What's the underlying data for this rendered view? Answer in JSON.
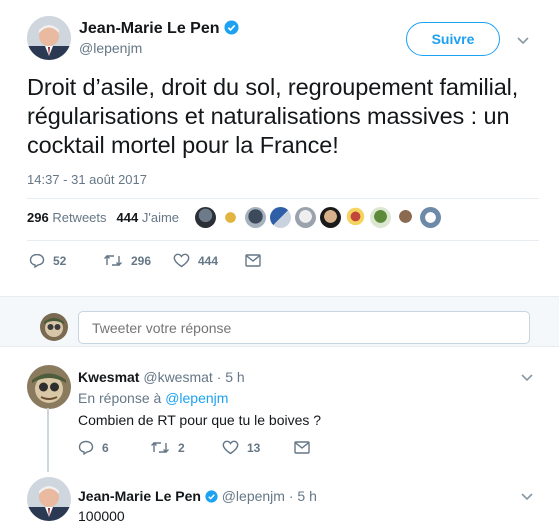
{
  "main_tweet": {
    "author_name": "Jean-Marie Le Pen",
    "author_handle": "@lepenjm",
    "follow_label": "Suivre",
    "text": "Droit d’asile, droit du sol, regroupement familial, régularisations et naturalisations massives : un cocktail mortel pour la France!",
    "timestamp": "14:37 - 31 août 2017",
    "retweets_count": "296",
    "retweets_label": "Retweets",
    "likes_count": "444",
    "likes_label": "J'aime",
    "actions": {
      "replies": "52",
      "retweets": "296",
      "likes": "444"
    }
  },
  "reply_box": {
    "placeholder": "Tweeter votre réponse"
  },
  "replies": [
    {
      "author_name": "Kwesmat",
      "author_handle": "@kwesmat",
      "time": "· 5 h",
      "reply_to_prefix": "En réponse à",
      "reply_to_handle": "@lepenjm",
      "text": "Combien de RT pour que tu le boives ?",
      "actions": {
        "replies": "6",
        "retweets": "2",
        "likes": "13"
      }
    },
    {
      "author_name": "Jean-Marie Le Pen",
      "author_handle": "@lepenjm",
      "time": "· 5 h",
      "text": "100000"
    }
  ],
  "colors": {
    "accent": "#1da1f2",
    "muted": "#657786",
    "text": "#14171a",
    "divider": "#e6ecf0",
    "band": "#f5f8fa"
  },
  "icons": [
    "verified-badge-icon",
    "chevron-down-icon",
    "reply-icon",
    "retweet-icon",
    "like-icon",
    "message-icon"
  ]
}
